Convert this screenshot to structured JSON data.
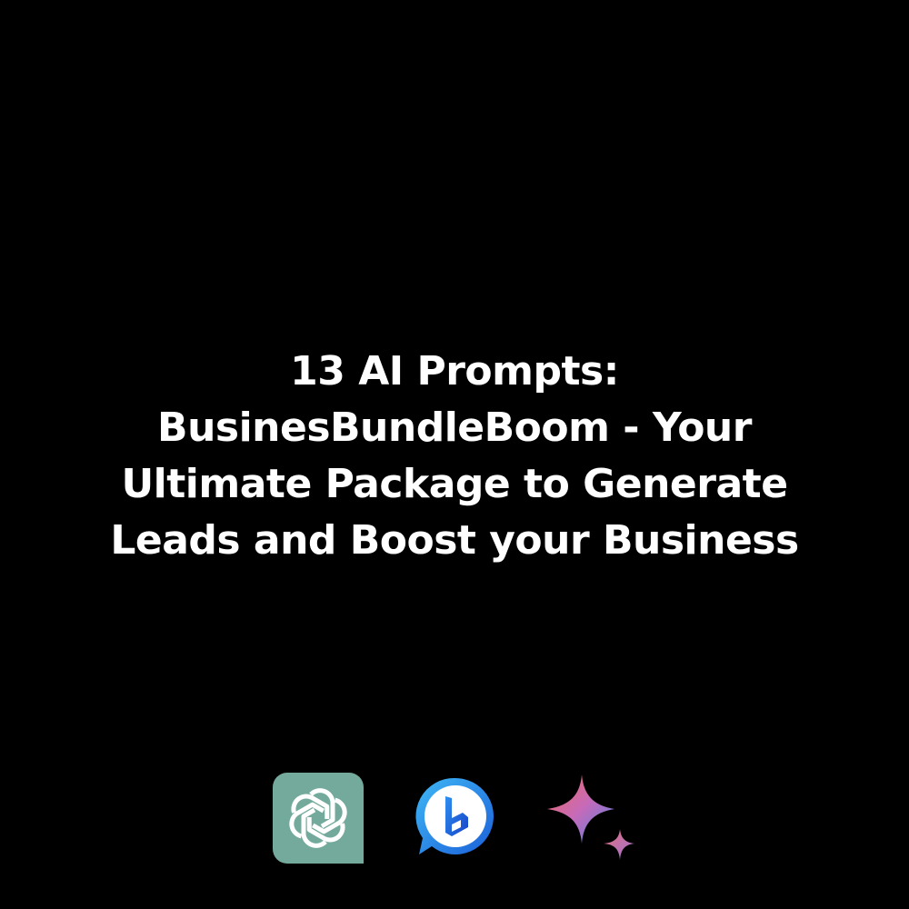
{
  "headline": {
    "lines": [
      "13 AI Prompts:",
      "BusinesBundleBoom - Your",
      "Ultimate Package to Generate",
      "Leads and Boost your Business"
    ]
  },
  "icons": [
    {
      "name": "chatgpt-logo-icon",
      "bg": "#74AA9C"
    },
    {
      "name": "bing-chat-logo-icon"
    },
    {
      "name": "gemini-sparkle-icon"
    }
  ],
  "colors": {
    "background": "#000000",
    "text": "#ffffff",
    "chatgpt": "#74AA9C",
    "bing_blue": "#1B6FE0",
    "gemini_pink": "#D96570",
    "gemini_blue": "#4E83E8"
  }
}
